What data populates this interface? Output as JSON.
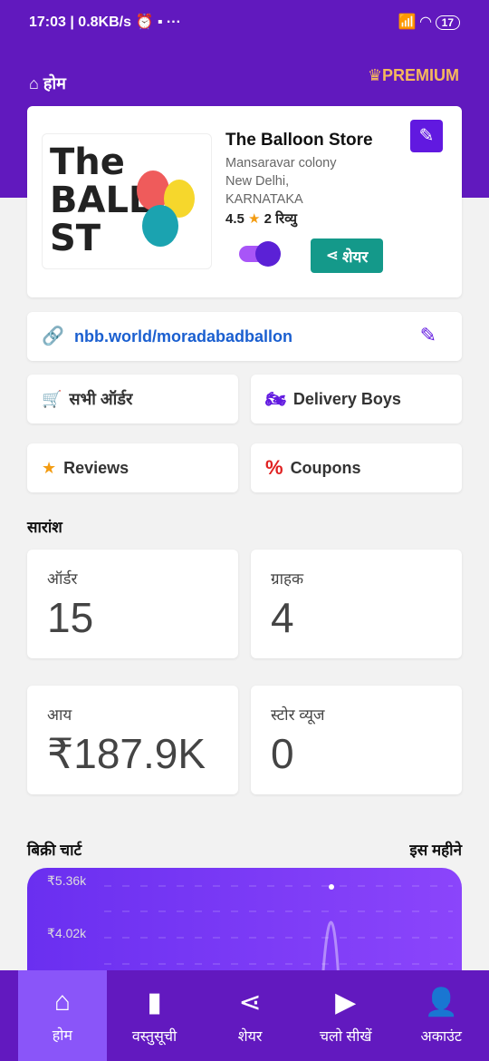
{
  "status_bar": {
    "time": "17:03",
    "speed": "0.8KB/s",
    "battery": "17"
  },
  "header": {
    "title": "होम",
    "premium": "PREMIUM"
  },
  "store": {
    "name": "The Balloon Store",
    "address1": "Mansaravar colony",
    "address2": "New Delhi,",
    "state": "KARNATAKA",
    "rating": "4.5",
    "reviews": "2 रिव्यु",
    "share": "शेयर",
    "toggle_on": true,
    "logo_text": "The BALLOON STORE"
  },
  "link": {
    "url": "nbb.world/moradabadballon"
  },
  "actions": [
    {
      "label": "सभी ऑर्डर",
      "icon": "cart-icon"
    },
    {
      "label": "Delivery Boys",
      "icon": "motorcycle-icon"
    },
    {
      "label": "Reviews",
      "icon": "star-icon"
    },
    {
      "label": "Coupons",
      "icon": "percent-icon"
    }
  ],
  "summary": {
    "title": "सारांश",
    "stats": [
      {
        "label": "ऑर्डर",
        "value": "15"
      },
      {
        "label": "ग्राहक",
        "value": "4"
      },
      {
        "label": "आय",
        "value": "₹187.9K"
      },
      {
        "label": "स्टोर व्यूज",
        "value": "0"
      }
    ]
  },
  "sales": {
    "title": "बिक्री चार्ट",
    "period": "इस महीने"
  },
  "chart_data": {
    "type": "line",
    "yticks": [
      "₹5.36k",
      "₹4.02k"
    ],
    "peak_value": 5360,
    "grid": true
  },
  "nav": [
    {
      "label": "होम",
      "icon": "home-icon"
    },
    {
      "label": "वस्तुसूची",
      "icon": "book-icon"
    },
    {
      "label": "शेयर",
      "icon": "share-icon"
    },
    {
      "label": "चलो सीखें",
      "icon": "play-icon"
    },
    {
      "label": "अकाउंट",
      "icon": "user-icon"
    }
  ],
  "colors": {
    "primary": "#6119be",
    "accent": "#8a55f9",
    "share": "#14998a",
    "premium": "#f5b85c"
  }
}
